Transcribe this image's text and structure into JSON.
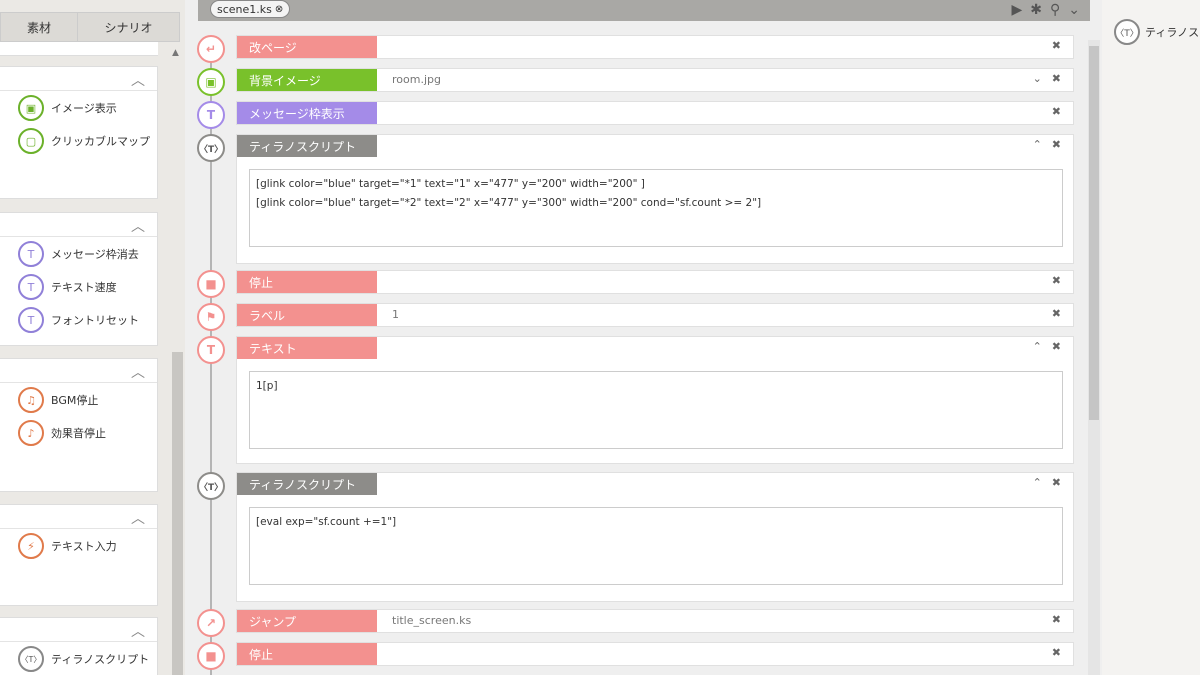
{
  "left_panel": {
    "tabs": [
      "素材",
      "シナリオ"
    ],
    "groups": [
      {
        "items": [
          {
            "label": "イメージ表示",
            "icon": "image-icon"
          },
          {
            "label": "クリッカブルマップ",
            "icon": "frame-icon"
          }
        ]
      },
      {
        "items": [
          {
            "label": "メッセージ枠消去",
            "icon": "text-erase-icon"
          },
          {
            "label": "テキスト速度",
            "icon": "text-speed-icon"
          },
          {
            "label": "フォントリセット",
            "icon": "font-reset-icon"
          }
        ]
      },
      {
        "items": [
          {
            "label": "BGM停止",
            "icon": "bgm-stop-icon"
          },
          {
            "label": "効果音停止",
            "icon": "se-stop-icon"
          }
        ]
      },
      {
        "items": [
          {
            "label": "テキスト入力",
            "icon": "lightning-icon"
          }
        ]
      },
      {
        "items": [
          {
            "label": "ティラノスクリプト",
            "icon": "tyrano-icon"
          }
        ]
      }
    ]
  },
  "editor": {
    "file_tab": "scene1.ks",
    "rows": [
      {
        "tag": "改ページ",
        "value": ""
      },
      {
        "tag": "背景イメージ",
        "value": "room.jpg"
      },
      {
        "tag": "メッセージ枠表示",
        "value": ""
      },
      {
        "tag": "ティラノスクリプト",
        "code": "[glink color=\"blue\" target=\"*1\" text=\"1\" x=\"477\" y=\"200\" width=\"200\" ]\n[glink color=\"blue\" target=\"*2\" text=\"2\" x=\"477\" y=\"300\" width=\"200\" cond=\"sf.count >= 2\"]"
      },
      {
        "tag": "停止",
        "value": ""
      },
      {
        "tag": "ラベル",
        "value": "1"
      },
      {
        "tag": "テキスト",
        "code": "1[p]"
      },
      {
        "tag": "ティラノスクリプト",
        "code": "[eval exp=\"sf.count +=1\"]"
      },
      {
        "tag": "ジャンプ",
        "value": "title_screen.ks"
      },
      {
        "tag": "停止",
        "value": ""
      }
    ]
  },
  "right_panel": {
    "item": "ティラノスクリプト"
  },
  "glyphs": {
    "close": "✖",
    "collapse": "⌃",
    "dropdown": "⌄",
    "caret_up": "︿",
    "tyrano": "〈T〉"
  }
}
